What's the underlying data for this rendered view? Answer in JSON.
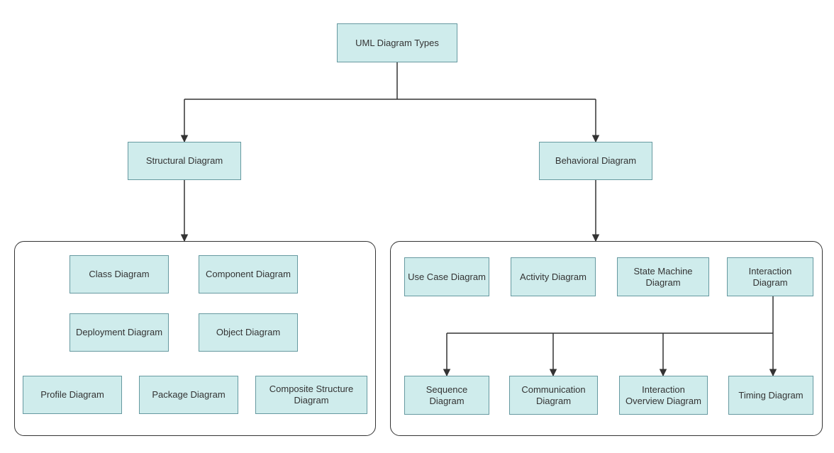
{
  "root": {
    "title": "UML Diagram Types"
  },
  "structural": {
    "title": "Structural Diagram",
    "children": {
      "class": "Class Diagram",
      "component": "Component Diagram",
      "deployment": "Deployment Diagram",
      "object": "Object Diagram",
      "profile": "Profile Diagram",
      "package": "Package Diagram",
      "composite": "Composite Structure Diagram"
    }
  },
  "behavioral": {
    "title": "Behavioral Diagram",
    "children": {
      "usecase": "Use Case Diagram",
      "activity": "Activity Diagram",
      "statemachine": "State Machine Diagram",
      "interaction": {
        "title": "Interaction Diagram",
        "children": {
          "sequence": "Sequence Diagram",
          "communication": "Communication Diagram",
          "overview": "Interaction Overview Diagram",
          "timing": "Timing Diagram"
        }
      }
    }
  }
}
